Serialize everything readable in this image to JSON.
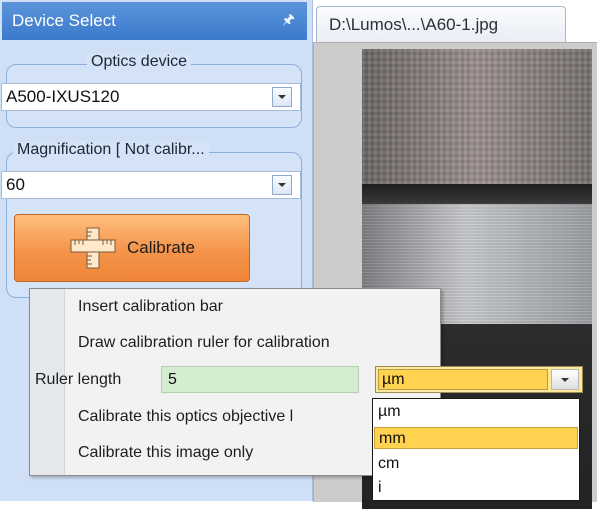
{
  "panel": {
    "title": "Device Select",
    "pin_icon": "pin-icon",
    "optics_group": {
      "legend": "Optics device",
      "value": "A500-IXUS120"
    },
    "magnification_group": {
      "legend": "Magnification [ Not calibr...",
      "value": "60"
    },
    "calibrate_button": {
      "label": "Calibrate",
      "icon": "ruler-icon"
    }
  },
  "document_tab": {
    "label": "D:\\Lumos\\...\\A60-1.jpg"
  },
  "context_menu": {
    "items": [
      {
        "label": "Insert calibration bar"
      },
      {
        "label": "Draw calibration ruler for calibration"
      },
      {
        "label": "Calibrate this optics objective l"
      },
      {
        "label": "Calibrate this image only"
      }
    ],
    "ruler_length": {
      "label": "Ruler length",
      "value": "5",
      "unit": "µm"
    }
  },
  "unit_dropdown": {
    "options": [
      "µm",
      "mm",
      "cm",
      "i"
    ],
    "highlighted": "mm"
  },
  "colors": {
    "panel_bg": "#cfe0f6",
    "header_blue": "#3b79cb",
    "calibrate_orange": "#f4944a",
    "input_green": "#d4edd0",
    "select_yellow": "#ffd24f"
  }
}
